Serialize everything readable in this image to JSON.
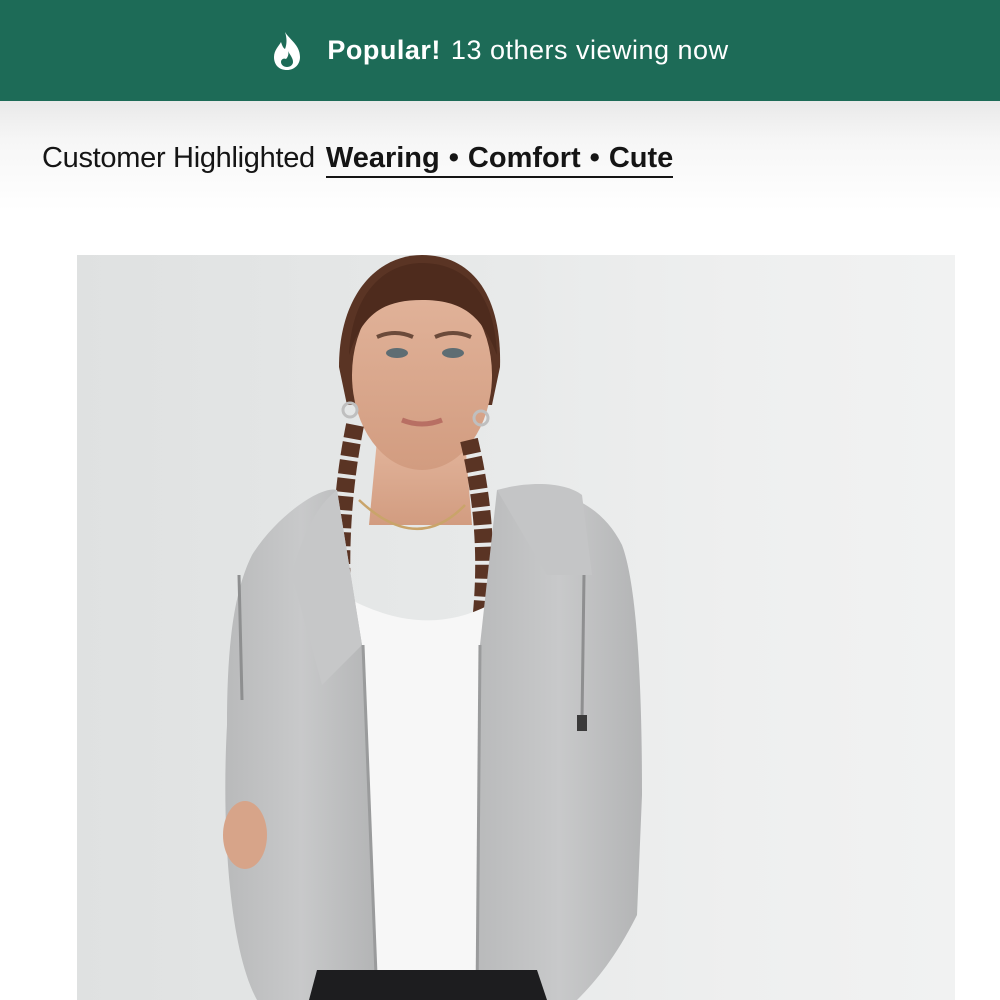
{
  "banner": {
    "icon": "flame-icon",
    "highlight": "Popular!",
    "text": "13 others viewing now",
    "background": "#1d6b57"
  },
  "highlights": {
    "lead": "Customer Highlighted",
    "tags": [
      "Wearing",
      "Comfort",
      "Cute"
    ],
    "separator": "•"
  },
  "product_image": {
    "alt": "Model wearing grey heather zip-up hoodie with white tank top"
  }
}
